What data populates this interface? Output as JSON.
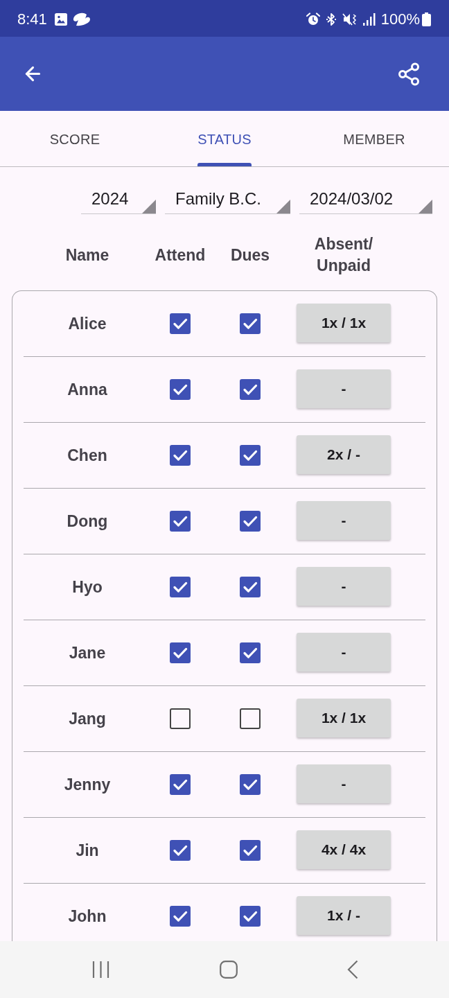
{
  "status_bar": {
    "time": "8:41",
    "battery": "100%"
  },
  "tabs": [
    {
      "label": "SCORE",
      "selected": false
    },
    {
      "label": "STATUS",
      "selected": true
    },
    {
      "label": "MEMBER",
      "selected": false
    }
  ],
  "filters": [
    {
      "value": "2024"
    },
    {
      "value": "Family B.C."
    },
    {
      "value": "2024/03/02"
    }
  ],
  "table": {
    "columns": [
      "Name",
      "Attend",
      "Dues",
      "Absent/ Unpaid"
    ],
    "rows": [
      {
        "name": "Alice",
        "attend": true,
        "dues": true,
        "absent_unpaid": "1x / 1x"
      },
      {
        "name": "Anna",
        "attend": true,
        "dues": true,
        "absent_unpaid": "-"
      },
      {
        "name": "Chen",
        "attend": true,
        "dues": true,
        "absent_unpaid": "2x / -"
      },
      {
        "name": "Dong",
        "attend": true,
        "dues": true,
        "absent_unpaid": "-"
      },
      {
        "name": "Hyo",
        "attend": true,
        "dues": true,
        "absent_unpaid": "-"
      },
      {
        "name": "Jane",
        "attend": true,
        "dues": true,
        "absent_unpaid": "-"
      },
      {
        "name": "Jang",
        "attend": false,
        "dues": false,
        "absent_unpaid": "1x / 1x"
      },
      {
        "name": "Jenny",
        "attend": true,
        "dues": true,
        "absent_unpaid": "-"
      },
      {
        "name": "Jin",
        "attend": true,
        "dues": true,
        "absent_unpaid": "4x / 4x"
      },
      {
        "name": "John",
        "attend": true,
        "dues": true,
        "absent_unpaid": "1x / -"
      }
    ]
  }
}
